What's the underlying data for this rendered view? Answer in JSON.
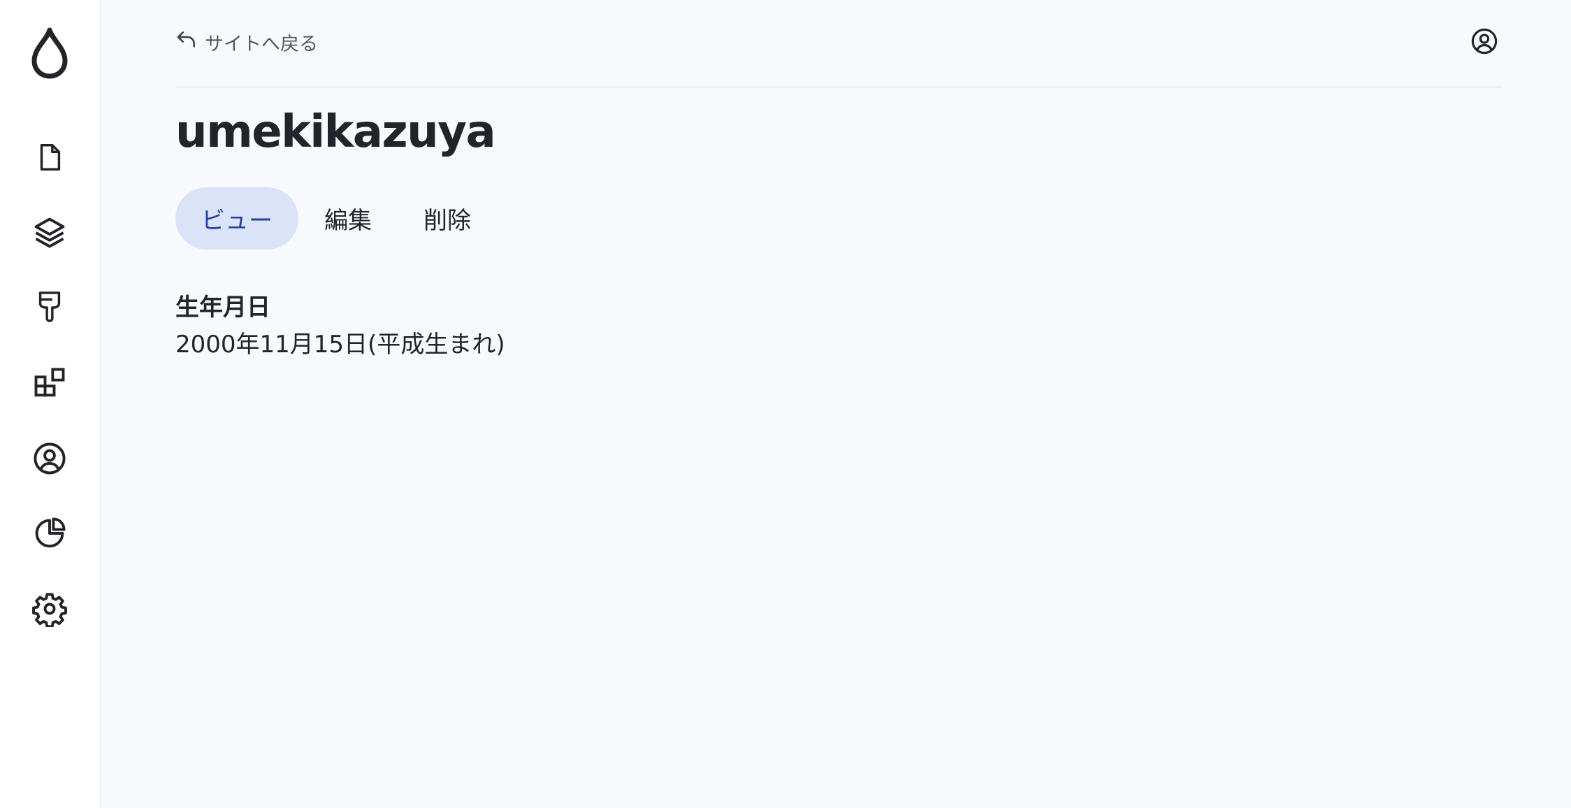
{
  "sidebar": {
    "logo_icon": "drupal-drop-icon",
    "items": [
      {
        "icon": "file-icon",
        "name": "content"
      },
      {
        "icon": "layers-icon",
        "name": "structure"
      },
      {
        "icon": "paint-brush-icon",
        "name": "appearance"
      },
      {
        "icon": "extensions-icon",
        "name": "extend"
      },
      {
        "icon": "user-circle-icon",
        "name": "people"
      },
      {
        "icon": "pie-chart-icon",
        "name": "reports"
      },
      {
        "icon": "gear-icon",
        "name": "configuration"
      }
    ]
  },
  "topbar": {
    "back_label": "サイトへ戻る",
    "user_icon": "user-circle-icon"
  },
  "page": {
    "title": "umekikazuya"
  },
  "tabs": [
    {
      "label": "ビュー",
      "active": true
    },
    {
      "label": "編集",
      "active": false
    },
    {
      "label": "削除",
      "active": false
    }
  ],
  "fields": {
    "birthday": {
      "label": "生年月日",
      "value": "2000年11月15日(平成生まれ)"
    }
  },
  "colors": {
    "background": "#f7f9fd",
    "sidebar": "#ffffff",
    "active_tab_bg": "#dbe3f9",
    "active_tab_text": "#2342a6",
    "text": "#232429"
  }
}
